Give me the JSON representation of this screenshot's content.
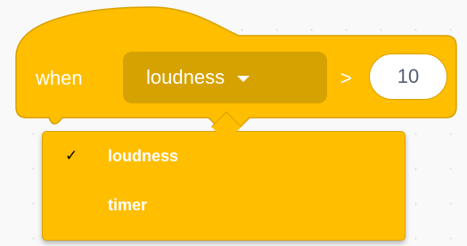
{
  "hat_block": {
    "when_label": "when",
    "sensor_dropdown": {
      "selected": "loudness"
    },
    "operator_label": ">",
    "value_input": "10"
  },
  "dropdown_menu": {
    "items": [
      {
        "label": "loudness",
        "checked": true,
        "check_glyph": "✓"
      },
      {
        "label": "timer",
        "checked": false,
        "check_glyph": ""
      }
    ]
  },
  "colors": {
    "block_fill": "#ffbe00",
    "block_border": "#d9a100",
    "dropdown_field": "#d6a201",
    "input_text": "#575e75",
    "workspace": "#f9f9f9"
  }
}
